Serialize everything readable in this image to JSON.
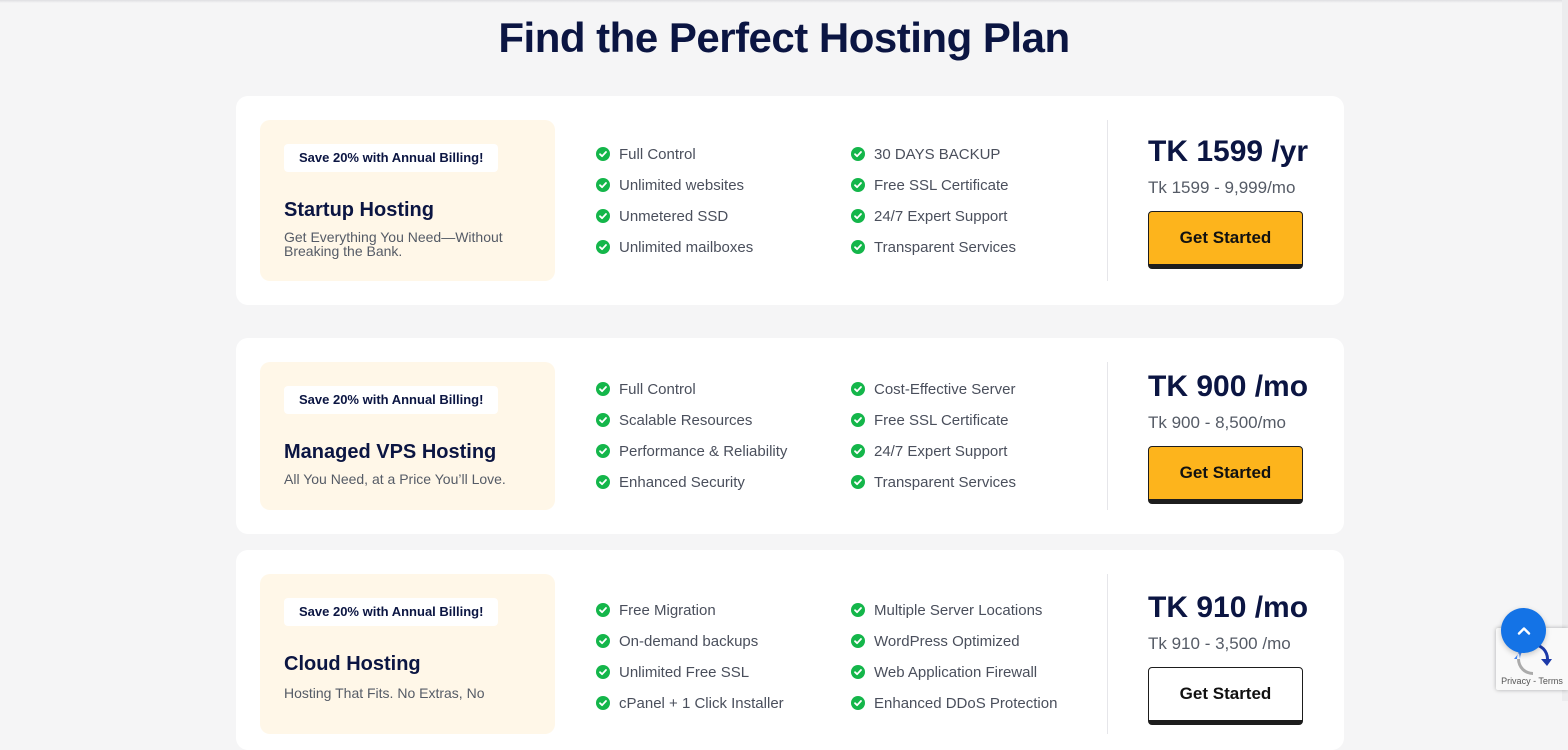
{
  "page": {
    "title": "Find the Perfect Hosting Plan"
  },
  "plans": [
    {
      "badge": "Save 20% with Annual Billing!",
      "name": "Startup Hosting",
      "tagline": "Get Everything You Need—Without Breaking the Bank.",
      "features_left": [
        "Full Control",
        "Unlimited websites",
        "Unmetered SSD",
        "Unlimited mailboxes"
      ],
      "features_right": [
        "30 DAYS BACKUP",
        "Free SSL Certificate",
        "24/7 Expert Support",
        "Transparent Services"
      ],
      "price": "TK 1599 /yr",
      "price_range": "Tk 1599 - 9,999/mo",
      "cta_label": "Get Started"
    },
    {
      "badge": "Save 20% with Annual Billing!",
      "name": "Managed VPS Hosting",
      "tagline": "All You Need, at a Price You’ll Love.",
      "features_left": [
        "Full Control",
        "Scalable Resources",
        "Performance & Reliability",
        "Enhanced Security"
      ],
      "features_right": [
        "Cost-Effective Server",
        "Free SSL Certificate",
        "24/7 Expert Support",
        "Transparent Services"
      ],
      "price": "TK 900 /mo",
      "price_range": "Tk 900 - 8,500/mo",
      "cta_label": "Get Started"
    },
    {
      "badge": "Save 20% with Annual Billing!",
      "name": "Cloud Hosting",
      "tagline": "Hosting That Fits. No Extras, No",
      "features_left": [
        "Free Migration",
        "On-demand backups",
        "Unlimited Free SSL",
        "cPanel + 1 Click Installer"
      ],
      "features_right": [
        "Multiple Server Locations",
        "WordPress Optimized",
        "Web Application Firewall",
        "Enhanced DDoS Protection"
      ],
      "price": "TK 910 /mo",
      "price_range": "Tk 910 - 3,500 /mo",
      "cta_label": "Get Started"
    }
  ],
  "recaptcha": {
    "privacy_label": "Privacy",
    "separator": " - ",
    "terms_label": "Terms"
  },
  "colors": {
    "accent": "#fdb41c",
    "brand_navy": "#0b1542",
    "check_green": "#14b64a",
    "scroll_top_blue": "#1473e6"
  },
  "icons": {
    "feature_check": "check-circle-icon",
    "scroll_top": "chevron-up-icon",
    "recaptcha": "recaptcha-logo-icon"
  }
}
